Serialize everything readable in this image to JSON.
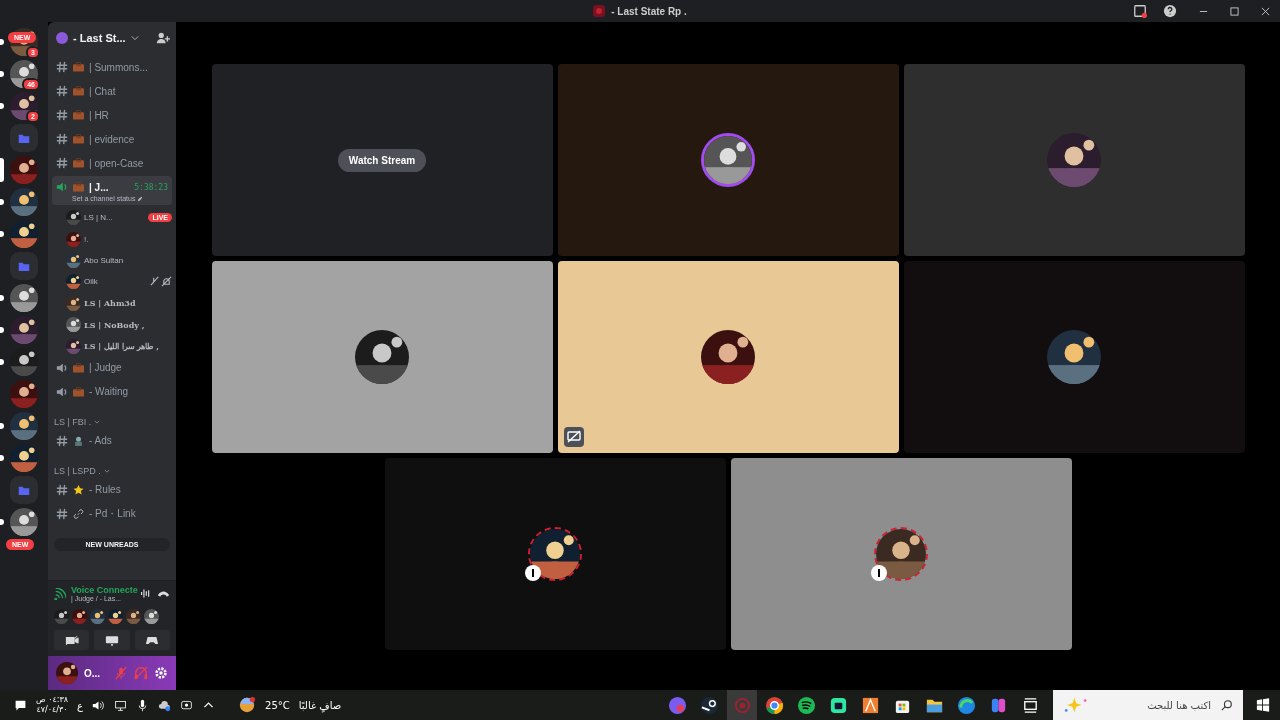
{
  "window": {
    "title": "- Last State Rp ."
  },
  "servers": [
    {
      "kind": "server",
      "unread": true,
      "badge": "3",
      "new_label": "NEW"
    },
    {
      "kind": "server",
      "unread": true,
      "badge": "46"
    },
    {
      "kind": "server",
      "unread": true,
      "badge": "2"
    },
    {
      "kind": "folder",
      "unread": false
    },
    {
      "kind": "server",
      "unread": false,
      "selected": true
    },
    {
      "kind": "server",
      "unread": true
    },
    {
      "kind": "server",
      "unread": true
    },
    {
      "kind": "folder",
      "unread": false
    },
    {
      "kind": "server",
      "unread": true
    },
    {
      "kind": "server",
      "unread": true
    },
    {
      "kind": "server",
      "unread": true
    },
    {
      "kind": "server",
      "unread": false
    },
    {
      "kind": "server",
      "unread": true
    },
    {
      "kind": "server",
      "unread": true
    },
    {
      "kind": "folder",
      "unread": false
    },
    {
      "kind": "server",
      "unread": true
    }
  ],
  "rail_new_pill": "NEW",
  "guild": {
    "name": "- Last St..."
  },
  "channels": [
    {
      "kind": "text",
      "name": "| Summons..."
    },
    {
      "kind": "text",
      "name": "| Chat"
    },
    {
      "kind": "text",
      "name": "| HR"
    },
    {
      "kind": "text",
      "name": "| evidence"
    },
    {
      "kind": "text",
      "name": "| open-Case"
    },
    {
      "kind": "voice",
      "name": "| J...",
      "connected": true,
      "timer": "5:38:23",
      "status": "Set a channel status",
      "members": [
        {
          "name": "LS | N...",
          "live": "LIVE",
          "bold": false,
          "muted": false
        },
        {
          "name": "!.",
          "bold": false,
          "muted": false
        },
        {
          "name": "Abo Sultan",
          "bold": false,
          "muted": false
        },
        {
          "name": "Oilk",
          "bold": false,
          "muted": true
        },
        {
          "name": "LS | Ahm3d",
          "bold": true,
          "muted": false
        },
        {
          "name": "LS | NoBody ,",
          "bold": true,
          "muted": false
        },
        {
          "name": "LS | طاهر سرا الليل ,",
          "bold": true,
          "muted": false
        }
      ]
    },
    {
      "kind": "voice",
      "name": "| Judge",
      "connected": false
    },
    {
      "kind": "voice",
      "name": "- Waiting",
      "connected": false
    },
    {
      "kind": "category",
      "name": "LS | FBI ."
    },
    {
      "kind": "badged",
      "name": "- Ads"
    },
    {
      "kind": "category",
      "name": "LS | LSPD ."
    },
    {
      "kind": "starred",
      "name": "- Rules"
    },
    {
      "kind": "linked",
      "name": "- Pd・Link"
    }
  ],
  "new_unreads": "NEW UNREADS",
  "voice_panel": {
    "status": "Voice Connecte",
    "channel": "| Judge / - Las..."
  },
  "user": {
    "name": "O...",
    "mic_muted": true,
    "deafened": true
  },
  "tiles": [
    {
      "kind": "stream",
      "color": "#202124",
      "button": "Watch Stream"
    },
    {
      "kind": "camera",
      "color": "#25190f",
      "speaking": true,
      "sharing": false,
      "decorated": false
    },
    {
      "kind": "camera",
      "color": "#2e2e2e",
      "speaking": false,
      "sharing": false,
      "decorated": false
    },
    {
      "kind": "camera",
      "color": "#a3a3a3",
      "speaking": false,
      "sharing": false,
      "decorated": false
    },
    {
      "kind": "camera",
      "color": "#e8c894",
      "speaking": false,
      "sharing": true,
      "decorated": false
    },
    {
      "kind": "camera",
      "color": "#120d0e",
      "speaking": false,
      "sharing": false,
      "decorated": false
    },
    {
      "kind": "camera",
      "color": "#0f0f0f",
      "speaking": false,
      "sharing": false,
      "decorated": true
    },
    {
      "kind": "camera",
      "color": "#8e8e8e",
      "speaking": false,
      "sharing": false,
      "decorated": true
    }
  ],
  "taskbar": {
    "time": "٠٤:٣٨ ص",
    "date": "٤٧/٠٤/٣٠",
    "language": "ع",
    "weather_temp": "25°C",
    "weather_text": "صافٍ غالبًا",
    "search_placeholder": "اكتب هنا للبحث"
  }
}
